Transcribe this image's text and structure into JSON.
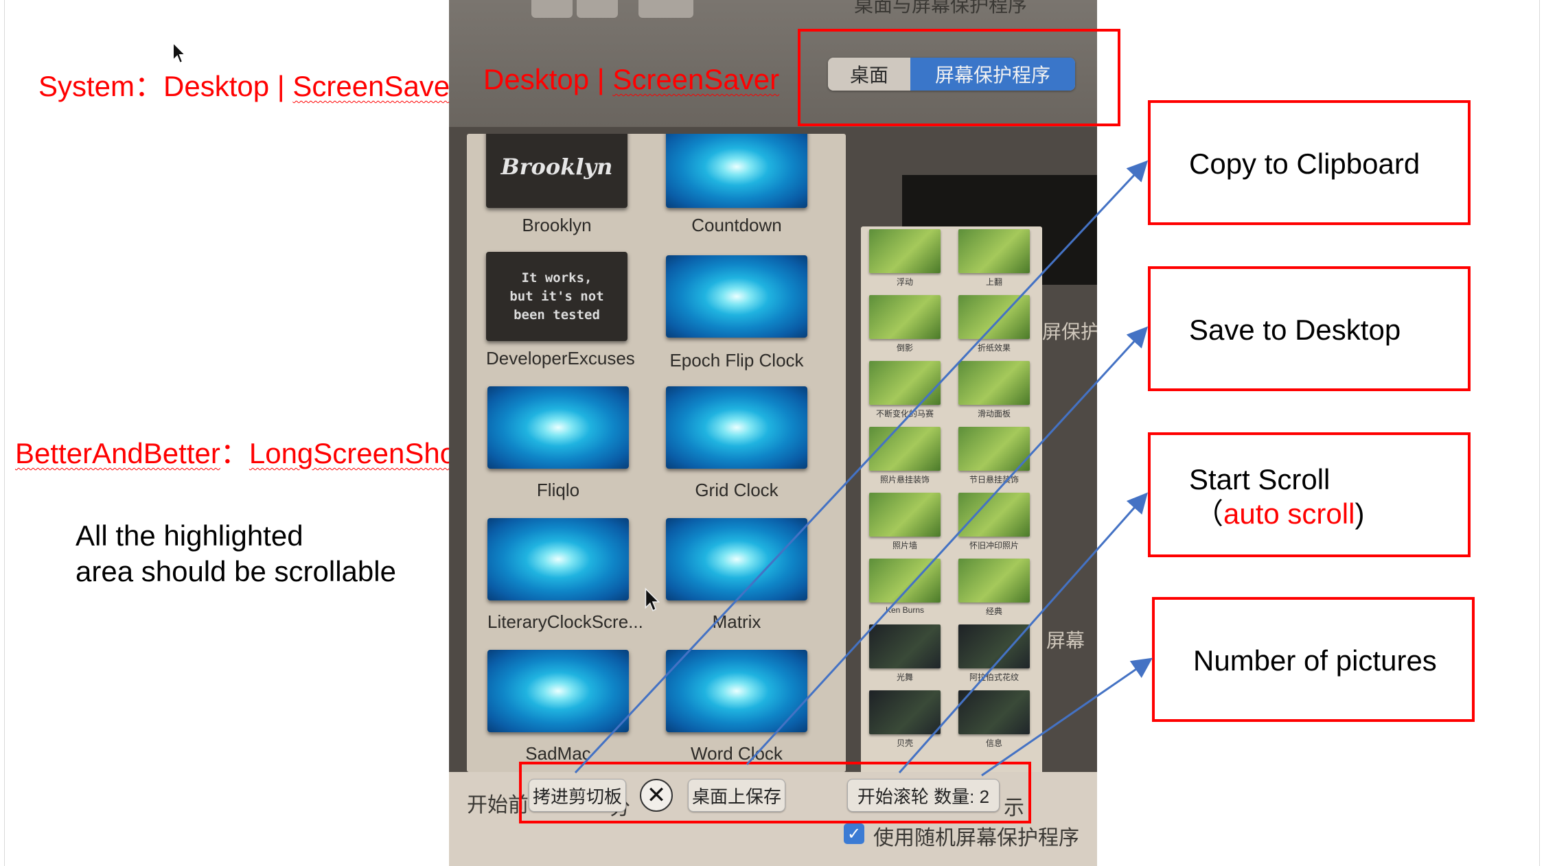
{
  "labels": {
    "system_prefix": "System",
    "system_sep": "：",
    "system_desktop": "Desktop",
    "system_bar": " | ",
    "system_screensaver": "ScreenSaver",
    "photo_desktop": "Desktop",
    "photo_bar": " | ",
    "photo_screensaver": "ScreenSaver",
    "bab_name": "BetterAndBetter",
    "bab_sep": "：",
    "bab_feature": "LongScreenShot",
    "note_line1": "All the highlighted",
    "note_line2": "area should be scrollable"
  },
  "photo": {
    "top_title": "桌面与屏幕保护程序",
    "segmented": {
      "tab_desktop": "桌面",
      "tab_screensaver": "屏幕保护程序"
    },
    "screensavers": [
      {
        "name": "Brooklyn",
        "thumb_text": "Brooklyn",
        "style": "script"
      },
      {
        "name": "Countdown",
        "thumb_text": "",
        "style": "swirl"
      },
      {
        "name": "DeveloperExcuses",
        "thumb_text": "It works,\nbut it's not\nbeen tested",
        "style": "dark"
      },
      {
        "name": "Epoch Flip Clock",
        "thumb_text": "",
        "style": "swirl"
      },
      {
        "name": "Fliqlo",
        "thumb_text": "",
        "style": "swirl"
      },
      {
        "name": "Grid Clock",
        "thumb_text": "",
        "style": "swirl"
      },
      {
        "name": "LiteraryClockScre...",
        "thumb_text": "",
        "style": "swirl"
      },
      {
        "name": "Matrix",
        "thumb_text": "",
        "style": "swirl"
      },
      {
        "name": "SadMac",
        "thumb_text": "",
        "style": "swirl"
      },
      {
        "name": "Word Clock",
        "thumb_text": "",
        "style": "swirl"
      }
    ],
    "mini_styles": [
      {
        "name": "浮动",
        "style": "green"
      },
      {
        "name": "上翻",
        "style": "green"
      },
      {
        "name": "倒影",
        "style": "green"
      },
      {
        "name": "折纸效果",
        "style": "green"
      },
      {
        "name": "不断变化的马赛",
        "style": "green"
      },
      {
        "name": "滑动面板",
        "style": "green"
      },
      {
        "name": "照片悬挂装饰",
        "style": "green"
      },
      {
        "name": "节日悬挂装饰",
        "style": "green"
      },
      {
        "name": "照片墙",
        "style": "green"
      },
      {
        "name": "怀旧冲印照片",
        "style": "green"
      },
      {
        "name": "Ken Burns",
        "style": "green"
      },
      {
        "name": "经典",
        "style": "green"
      },
      {
        "name": "光舞",
        "style": "dark"
      },
      {
        "name": "阿拉伯式花纹",
        "style": "dark"
      },
      {
        "name": "贝壳",
        "style": "dark"
      },
      {
        "name": "信息",
        "style": "dark"
      }
    ],
    "side_text_1": "屏保护程",
    "side_text_2": "屏幕",
    "bottom_start": "开始前",
    "bottom_fen": "分",
    "bottom_show": "示",
    "random_option": "使用随机屏幕保护程序",
    "checkbox_mark": "✓",
    "toolbar": {
      "copy_label": "拷进剪切板",
      "close_symbol": "✕",
      "save_label": "桌面上保存",
      "scroll_label": "开始滚轮  数量: 2"
    }
  },
  "callouts": {
    "copy": "Copy to Clipboard",
    "save": "Save to Desktop",
    "scroll_line1": "Start Scroll",
    "scroll_paren_open": "（",
    "scroll_auto": "auto scroll",
    "scroll_paren_close": ")",
    "count": "Number of pictures"
  },
  "colors": {
    "annotation_red": "#ff0000",
    "arrow_blue": "#4472c4",
    "selected_tab_blue": "#3a76c9"
  }
}
